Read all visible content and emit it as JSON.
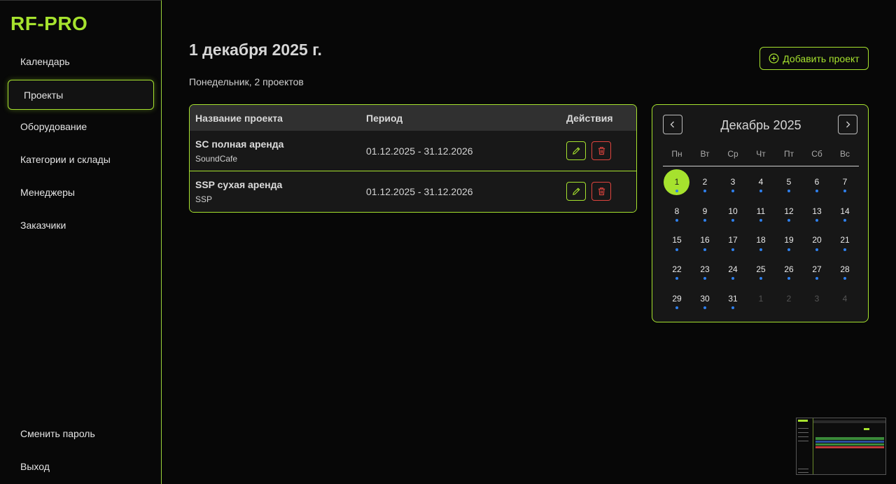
{
  "sidebar": {
    "logo": "RF-PRO",
    "items": [
      {
        "label": "Календарь"
      },
      {
        "label": "Проекты",
        "active": true
      },
      {
        "label": "Оборудование"
      },
      {
        "label": "Категории и склады"
      },
      {
        "label": "Менеджеры"
      },
      {
        "label": "Заказчики"
      }
    ],
    "bottom": [
      {
        "label": "Сменить пароль"
      },
      {
        "label": "Выход"
      }
    ]
  },
  "header": {
    "title": "1 декабря 2025 г.",
    "subtitle": "Понедельник, 2 проектов",
    "add_button": "Добавить проект"
  },
  "table": {
    "columns": [
      "Название проекта",
      "Период",
      "Действия"
    ],
    "rows": [
      {
        "name": "SC полная аренда",
        "client": "SoundCafe",
        "period": "01.12.2025 - 31.12.2026"
      },
      {
        "name": "SSP сухая аренда",
        "client": "SSP",
        "period": "01.12.2025 - 31.12.2026"
      }
    ]
  },
  "calendar": {
    "title": "Декабрь 2025",
    "weekdays": [
      "Пн",
      "Вт",
      "Ср",
      "Чт",
      "Пт",
      "Сб",
      "Вс"
    ],
    "selected_day": 1,
    "days": [
      {
        "n": "1",
        "dot": true,
        "selected": true
      },
      {
        "n": "2",
        "dot": true
      },
      {
        "n": "3",
        "dot": true
      },
      {
        "n": "4",
        "dot": true
      },
      {
        "n": "5",
        "dot": true
      },
      {
        "n": "6",
        "dot": true
      },
      {
        "n": "7",
        "dot": true
      },
      {
        "n": "8",
        "dot": true
      },
      {
        "n": "9",
        "dot": true
      },
      {
        "n": "10",
        "dot": true
      },
      {
        "n": "11",
        "dot": true
      },
      {
        "n": "12",
        "dot": true
      },
      {
        "n": "13",
        "dot": true
      },
      {
        "n": "14",
        "dot": true
      },
      {
        "n": "15",
        "dot": true
      },
      {
        "n": "16",
        "dot": true
      },
      {
        "n": "17",
        "dot": true
      },
      {
        "n": "18",
        "dot": true
      },
      {
        "n": "19",
        "dot": true
      },
      {
        "n": "20",
        "dot": true
      },
      {
        "n": "21",
        "dot": true
      },
      {
        "n": "22",
        "dot": true
      },
      {
        "n": "23",
        "dot": true
      },
      {
        "n": "24",
        "dot": true
      },
      {
        "n": "25",
        "dot": true
      },
      {
        "n": "26",
        "dot": true
      },
      {
        "n": "27",
        "dot": true
      },
      {
        "n": "28",
        "dot": true
      },
      {
        "n": "29",
        "dot": true
      },
      {
        "n": "30",
        "dot": true
      },
      {
        "n": "31",
        "dot": true
      },
      {
        "n": "1",
        "muted": true
      },
      {
        "n": "2",
        "muted": true
      },
      {
        "n": "3",
        "muted": true
      },
      {
        "n": "4",
        "muted": true
      }
    ]
  },
  "colors": {
    "accent": "#a6e22e",
    "danger": "#e0443e",
    "dot": "#2f80ed",
    "background": "#070707"
  },
  "icons": {
    "add": "plus-circle-icon",
    "edit": "pencil-icon",
    "delete": "trash-icon",
    "prev": "chevron-left-icon",
    "next": "chevron-right-icon"
  }
}
